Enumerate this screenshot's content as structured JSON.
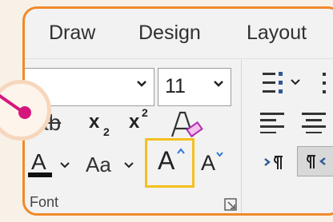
{
  "tabs": [
    {
      "label": "Draw"
    },
    {
      "label": "Design"
    },
    {
      "label": "Layout"
    }
  ],
  "font": {
    "name_value": "",
    "size_value": "11",
    "group_label": "Font",
    "strikethrough_label": "ab",
    "subscript_label": "x",
    "subscript_small": "2",
    "superscript_label": "x",
    "superscript_small": "2",
    "font_color_label": "A",
    "change_case_label": "Aa",
    "grow_font_label": "A",
    "shrink_font_label": "A"
  },
  "colors": {
    "frame_border": "#f08a2a",
    "highlight_border": "#f5c020",
    "pointer_dot": "#d5177d",
    "paragraph_icon": "#2b5797"
  },
  "icons": [
    "chevron-down-icon",
    "clear-formatting-icon",
    "grow-font-arrow-icon",
    "shrink-font-arrow-icon",
    "dialog-launcher-icon",
    "bullets-icon",
    "align-left-icon",
    "align-center-icon",
    "ltr-paragraph-icon",
    "rtl-paragraph-icon"
  ]
}
